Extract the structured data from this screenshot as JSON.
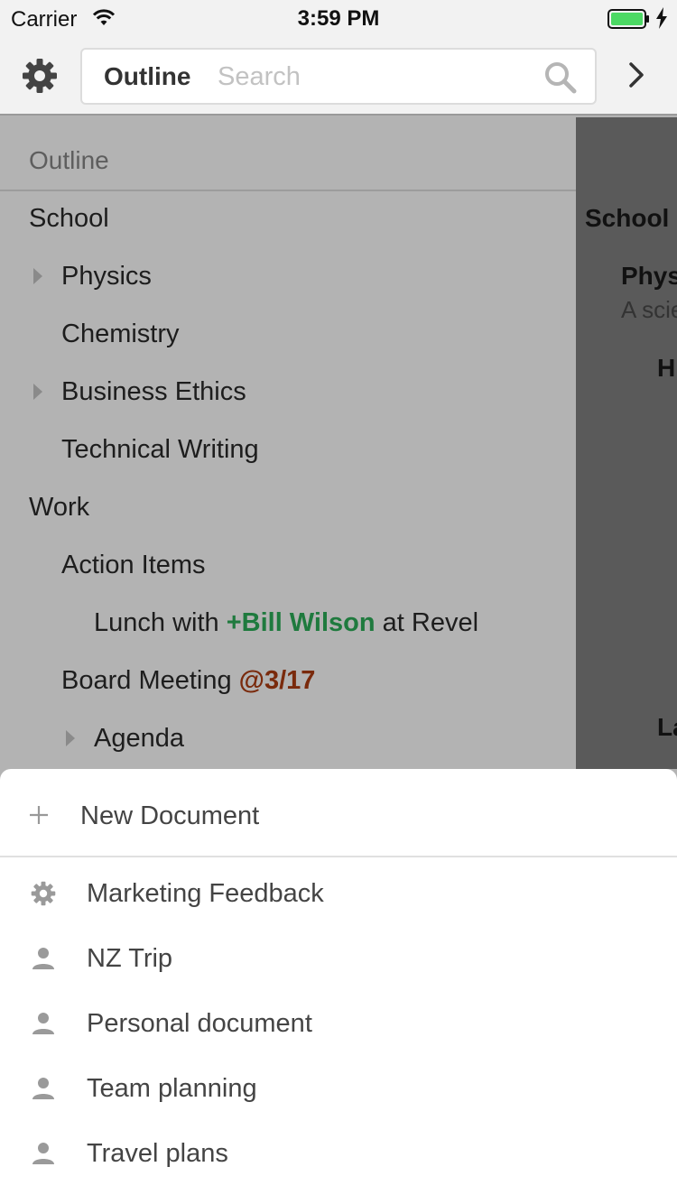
{
  "status_bar": {
    "carrier": "Carrier",
    "time": "3:59 PM"
  },
  "toolbar": {
    "scope_label": "Outline",
    "search_placeholder": "Search"
  },
  "outline": {
    "heading": "Outline",
    "rows": [
      {
        "text": "School",
        "expandable": false
      },
      {
        "text": "Physics",
        "expandable": true
      },
      {
        "text": "Chemistry",
        "expandable": false
      },
      {
        "text": "Business Ethics",
        "expandable": true
      },
      {
        "text": "Technical Writing",
        "expandable": false
      },
      {
        "text": "Work",
        "expandable": false
      },
      {
        "text": "Action Items",
        "expandable": false
      },
      {
        "prefix": "Lunch with ",
        "mention": "+Bill Wilson",
        "suffix": " at Revel"
      },
      {
        "prefix": "Board Meeting ",
        "date": "@3/17"
      },
      {
        "text": "Agenda",
        "expandable": true
      }
    ]
  },
  "preview": {
    "title": "School",
    "sub_title": "Phys",
    "sub_desc": "A scie",
    "item_h": "H",
    "item_la": "La"
  },
  "sheet": {
    "new_document_label": "New Document",
    "documents": [
      {
        "label": "Marketing Feedback",
        "icon": "gear-icon"
      },
      {
        "label": "NZ Trip",
        "icon": "person-icon"
      },
      {
        "label": "Personal document",
        "icon": "person-icon"
      },
      {
        "label": "Team planning",
        "icon": "person-icon"
      },
      {
        "label": "Travel plans",
        "icon": "person-icon"
      }
    ]
  },
  "colors": {
    "mention": "#1f7a3e",
    "date": "#7a2a0c",
    "battery": "#4cd964"
  }
}
